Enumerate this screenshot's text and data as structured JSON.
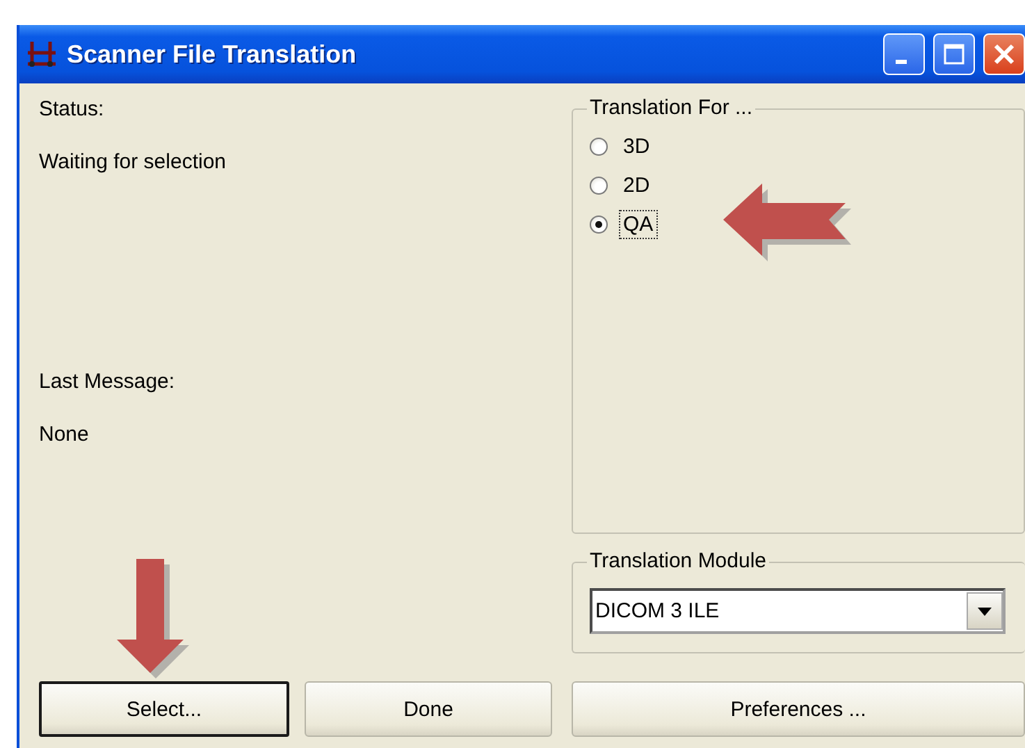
{
  "window": {
    "title": "Scanner File Translation"
  },
  "status": {
    "label": "Status:",
    "value": "Waiting for selection"
  },
  "last_message": {
    "label": "Last Message:",
    "value": "None"
  },
  "translation_for": {
    "label": "Translation For ...",
    "options": [
      {
        "label": "3D",
        "selected": false
      },
      {
        "label": "2D",
        "selected": false
      },
      {
        "label": "QA",
        "selected": true
      }
    ]
  },
  "translation_module": {
    "label": "Translation Module",
    "value": "DICOM 3 ILE"
  },
  "buttons": [
    {
      "label": "Select...",
      "default": true
    },
    {
      "label": "Done",
      "default": false
    },
    {
      "label": "Preferences ...",
      "default": false
    }
  ]
}
